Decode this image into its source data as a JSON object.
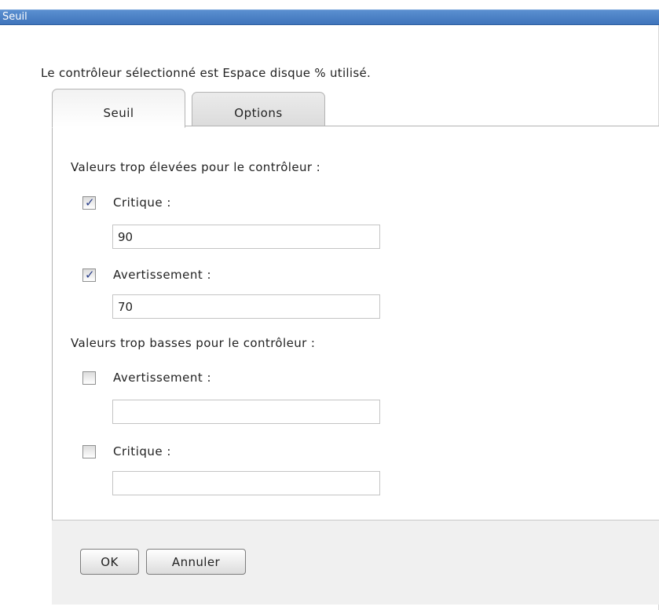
{
  "window": {
    "title": "Seuil"
  },
  "intro_text": "Le contrôleur sélectionné est Espace disque % utilisé.",
  "tabs": [
    {
      "label": "Seuil",
      "active": true
    },
    {
      "label": "Options",
      "active": false
    }
  ],
  "high_values": {
    "heading": "Valeurs trop élevées pour le contrôleur :",
    "critical": {
      "label": "Critique :",
      "checked": true,
      "value": "90"
    },
    "warning": {
      "label": "Avertissement :",
      "checked": true,
      "value": "70"
    }
  },
  "low_values": {
    "heading": "Valeurs trop basses pour le contrôleur :",
    "warning": {
      "label": "Avertissement :",
      "checked": false,
      "value": ""
    },
    "critical": {
      "label": "Critique :",
      "checked": false,
      "value": ""
    }
  },
  "buttons": {
    "ok_label": "OK",
    "cancel_label": "Annuler"
  },
  "colors": {
    "titlebar": "#4a80c6",
    "checkmark": "#2b3f8a",
    "footer_bg": "#f0f0f0"
  }
}
